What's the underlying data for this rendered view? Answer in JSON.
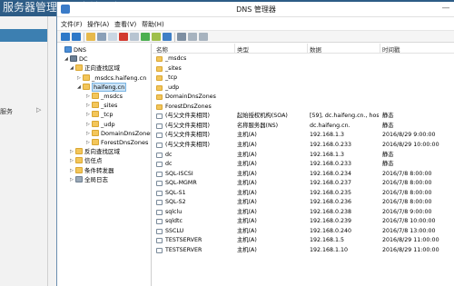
{
  "background_app": {
    "title": "服务器管理器  ·  本地服务器",
    "sidebar_label": "服务"
  },
  "window": {
    "title": "DNS 管理器"
  },
  "menu": [
    "文件(F)",
    "操作(A)",
    "查看(V)",
    "帮助(H)"
  ],
  "toolbar_icons": [
    "back-icon",
    "forward-icon",
    "up-folder-icon",
    "show-tree-icon",
    "copy-icon",
    "delete-icon",
    "properties-icon",
    "refresh-icon",
    "export-icon",
    "help-icon",
    "server-icon",
    "record-icon",
    "list-icon"
  ],
  "tree": [
    {
      "label": "DNS",
      "icon": "dns",
      "expander": ""
    },
    {
      "label": "DC",
      "icon": "server",
      "expander": "◢"
    },
    {
      "label": "正向查找区域",
      "icon": "folder",
      "expander": "◢"
    },
    {
      "label": "_msdcs.haifeng.cn",
      "icon": "folder",
      "expander": "▷"
    },
    {
      "label": "haifeng.cn",
      "icon": "folder",
      "expander": "◢",
      "selected": true
    },
    {
      "label": "_msdcs",
      "icon": "folder",
      "expander": "▷"
    },
    {
      "label": "_sites",
      "icon": "folder",
      "expander": "▷"
    },
    {
      "label": "_tcp",
      "icon": "folder",
      "expander": "▷"
    },
    {
      "label": "_udp",
      "icon": "folder",
      "expander": "▷"
    },
    {
      "label": "DomainDnsZones",
      "icon": "folder",
      "expander": "▷"
    },
    {
      "label": "ForestDnsZones",
      "icon": "folder",
      "expander": "▷"
    },
    {
      "label": "反向查找区域",
      "icon": "folder",
      "expander": "▷"
    },
    {
      "label": "信任点",
      "icon": "folder",
      "expander": "▷"
    },
    {
      "label": "条件转发器",
      "icon": "folder",
      "expander": "▷"
    },
    {
      "label": "全局日志",
      "icon": "log",
      "expander": "▷"
    }
  ],
  "columns": [
    "名称",
    "类型",
    "数据",
    "时间戳"
  ],
  "rows": [
    {
      "name": "_msdcs",
      "type": "",
      "data": "",
      "ts": "",
      "icon": "folder"
    },
    {
      "name": "_sites",
      "type": "",
      "data": "",
      "ts": "",
      "icon": "folder"
    },
    {
      "name": "_tcp",
      "type": "",
      "data": "",
      "ts": "",
      "icon": "folder"
    },
    {
      "name": "_udp",
      "type": "",
      "data": "",
      "ts": "",
      "icon": "folder"
    },
    {
      "name": "DomainDnsZones",
      "type": "",
      "data": "",
      "ts": "",
      "icon": "folder"
    },
    {
      "name": "ForestDnsZones",
      "type": "",
      "data": "",
      "ts": "",
      "icon": "folder"
    },
    {
      "name": "(与父文件夹相同)",
      "type": "起始授权机构(SOA)",
      "data": "[59], dc.haifeng.cn., hos...",
      "ts": "静态",
      "icon": "rec"
    },
    {
      "name": "(与父文件夹相同)",
      "type": "名称服务器(NS)",
      "data": "dc.haifeng.cn.",
      "ts": "静态",
      "icon": "rec"
    },
    {
      "name": "(与父文件夹相同)",
      "type": "主机(A)",
      "data": "192.168.1.3",
      "ts": "2016/8/29 9:00:00",
      "icon": "rec"
    },
    {
      "name": "(与父文件夹相同)",
      "type": "主机(A)",
      "data": "192.168.0.233",
      "ts": "2016/8/29 10:00:00",
      "icon": "rec"
    },
    {
      "name": "dc",
      "type": "主机(A)",
      "data": "192.168.1.3",
      "ts": "静态",
      "icon": "rec"
    },
    {
      "name": "dc",
      "type": "主机(A)",
      "data": "192.168.0.233",
      "ts": "静态",
      "icon": "rec"
    },
    {
      "name": "SQL-ISCSI",
      "type": "主机(A)",
      "data": "192.168.0.234",
      "ts": "2016/7/8 8:00:00",
      "icon": "rec"
    },
    {
      "name": "SQL-MGMR",
      "type": "主机(A)",
      "data": "192.168.0.237",
      "ts": "2016/7/8 8:00:00",
      "icon": "rec"
    },
    {
      "name": "SQL-S1",
      "type": "主机(A)",
      "data": "192.168.0.235",
      "ts": "2016/7/8 8:00:00",
      "icon": "rec"
    },
    {
      "name": "SQL-S2",
      "type": "主机(A)",
      "data": "192.168.0.236",
      "ts": "2016/7/8 8:00:00",
      "icon": "rec"
    },
    {
      "name": "sqlclu",
      "type": "主机(A)",
      "data": "192.168.0.238",
      "ts": "2016/7/8 9:00:00",
      "icon": "rec"
    },
    {
      "name": "sqldtc",
      "type": "主机(A)",
      "data": "192.168.0.239",
      "ts": "2016/7/8 10:00:00",
      "icon": "rec"
    },
    {
      "name": "SSCLU",
      "type": "主机(A)",
      "data": "192.168.0.240",
      "ts": "2016/7/8 13:00:00",
      "icon": "rec"
    },
    {
      "name": "TESTSERVER",
      "type": "主机(A)",
      "data": "192.168.1.5",
      "ts": "2016/8/29 11:00:00",
      "icon": "rec"
    },
    {
      "name": "TESTSERVER",
      "type": "主机(A)",
      "data": "192.168.1.10",
      "ts": "2016/8/29 11:00:00",
      "icon": "rec"
    }
  ]
}
